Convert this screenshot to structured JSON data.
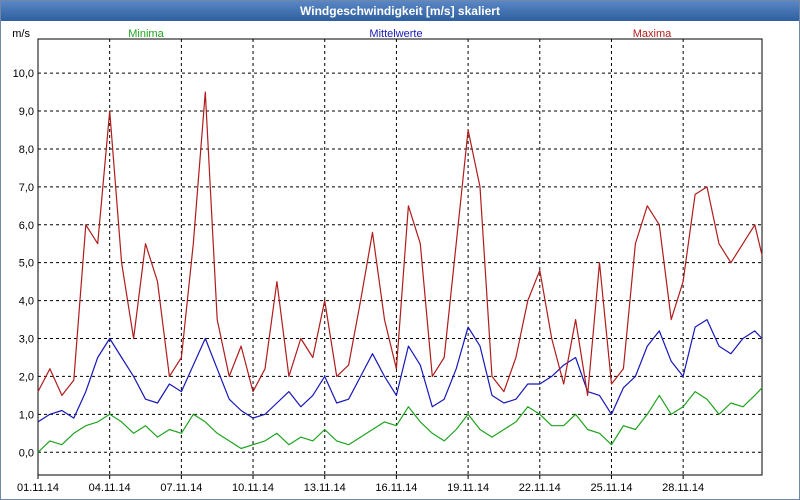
{
  "window": {
    "title": "Windgeschwindigkeit [m/s] skaliert"
  },
  "chart_data": {
    "type": "line",
    "title": "Windgeschwindigkeit [m/s] skaliert",
    "ylabel": "m/s",
    "ylim": [
      -0.6,
      10.9
    ],
    "y_ticks": [
      "0,0",
      "1,0",
      "2,0",
      "3,0",
      "4,0",
      "5,0",
      "6,0",
      "7,0",
      "8,0",
      "9,0",
      "10,0"
    ],
    "y_tick_values": [
      0,
      1,
      2,
      3,
      4,
      5,
      6,
      7,
      8,
      9,
      10
    ],
    "x_ticks": [
      "01.11.14",
      "04.11.14",
      "07.11.14",
      "10.11.14",
      "13.11.14",
      "16.11.14",
      "19.11.14",
      "22.11.14",
      "25.11.14",
      "28.11.14"
    ],
    "x_tick_values": [
      1,
      4,
      7,
      10,
      13,
      16,
      19,
      22,
      25,
      28
    ],
    "xlim": [
      1,
      31.3
    ],
    "grid": true,
    "legend_position": "top",
    "x": [
      1.0,
      1.5,
      2.0,
      2.5,
      3.0,
      3.5,
      4.0,
      4.5,
      5.0,
      5.5,
      6.0,
      6.5,
      7.0,
      7.5,
      8.0,
      8.5,
      9.0,
      9.5,
      10.0,
      10.5,
      11.0,
      11.5,
      12.0,
      12.5,
      13.0,
      13.5,
      14.0,
      14.5,
      15.0,
      15.5,
      16.0,
      16.5,
      17.0,
      17.5,
      18.0,
      18.5,
      19.0,
      19.5,
      20.0,
      20.5,
      21.0,
      21.5,
      22.0,
      22.5,
      23.0,
      23.5,
      24.0,
      24.5,
      25.0,
      25.5,
      26.0,
      26.5,
      27.0,
      27.5,
      28.0,
      28.5,
      29.0,
      29.5,
      30.0,
      30.5,
      31.0,
      31.3
    ],
    "series": [
      {
        "name": "Minima",
        "color": "#1fa31f",
        "values": [
          0.0,
          0.3,
          0.2,
          0.5,
          0.7,
          0.8,
          1.0,
          0.8,
          0.5,
          0.7,
          0.4,
          0.6,
          0.5,
          1.0,
          0.8,
          0.5,
          0.3,
          0.1,
          0.2,
          0.3,
          0.5,
          0.2,
          0.4,
          0.3,
          0.6,
          0.3,
          0.2,
          0.4,
          0.6,
          0.8,
          0.7,
          1.2,
          0.8,
          0.5,
          0.3,
          0.6,
          1.0,
          0.6,
          0.4,
          0.6,
          0.8,
          1.2,
          1.0,
          0.7,
          0.7,
          1.0,
          0.6,
          0.5,
          0.2,
          0.7,
          0.6,
          1.0,
          1.5,
          1.0,
          1.2,
          1.6,
          1.4,
          1.0,
          1.3,
          1.2,
          1.5,
          1.7
        ]
      },
      {
        "name": "Mittelwerte",
        "color": "#1818b8",
        "values": [
          0.8,
          1.0,
          1.1,
          0.9,
          1.6,
          2.5,
          3.0,
          2.5,
          2.0,
          1.4,
          1.3,
          1.8,
          1.6,
          2.3,
          3.0,
          2.2,
          1.4,
          1.1,
          0.9,
          1.0,
          1.3,
          1.6,
          1.2,
          1.5,
          2.0,
          1.3,
          1.4,
          2.0,
          2.6,
          2.0,
          1.5,
          2.8,
          2.3,
          1.2,
          1.4,
          2.2,
          3.3,
          2.8,
          1.5,
          1.3,
          1.4,
          1.8,
          1.8,
          2.0,
          2.3,
          2.5,
          1.6,
          1.5,
          1.0,
          1.7,
          2.0,
          2.8,
          3.2,
          2.4,
          2.0,
          3.3,
          3.5,
          2.8,
          2.6,
          3.0,
          3.2,
          3.0
        ]
      },
      {
        "name": "Maxima",
        "color": "#b01c1c",
        "values": [
          1.6,
          2.2,
          1.5,
          1.9,
          6.0,
          5.5,
          9.0,
          5.0,
          3.0,
          5.5,
          4.5,
          2.0,
          2.5,
          5.5,
          9.5,
          3.5,
          2.0,
          2.8,
          1.6,
          2.2,
          4.5,
          2.0,
          3.0,
          2.5,
          4.0,
          2.0,
          2.3,
          4.0,
          5.8,
          3.5,
          2.2,
          6.5,
          5.5,
          2.0,
          2.5,
          5.5,
          8.5,
          7.0,
          2.0,
          1.6,
          2.5,
          4.0,
          4.8,
          3.0,
          1.8,
          3.5,
          1.5,
          5.0,
          1.8,
          2.2,
          5.5,
          6.5,
          6.0,
          3.5,
          4.5,
          6.8,
          7.0,
          5.5,
          5.0,
          5.5,
          6.0,
          5.2
        ]
      }
    ]
  }
}
